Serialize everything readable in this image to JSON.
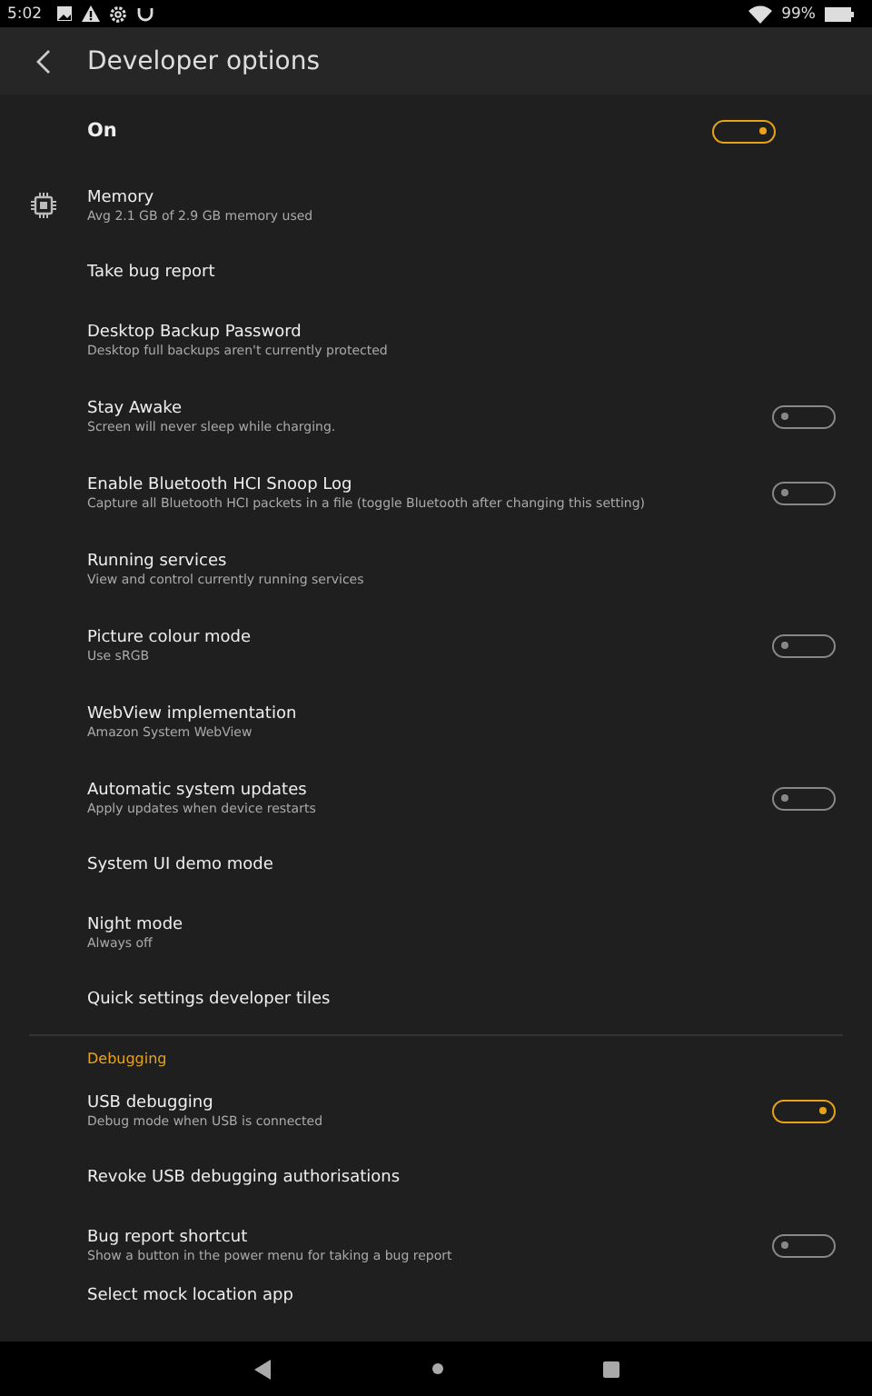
{
  "status_bar": {
    "time": "5:02",
    "battery": "99%"
  },
  "app_bar": {
    "title": "Developer options"
  },
  "master": {
    "label": "On",
    "on": true
  },
  "sections": [
    {
      "items": [
        {
          "kind": "icon",
          "title": "Memory",
          "summary": "Avg 2.1 GB of 2.9 GB memory used"
        },
        {
          "kind": "plain",
          "title": "Take bug report"
        },
        {
          "kind": "plain",
          "title": "Desktop Backup Password",
          "summary": "Desktop full backups aren't currently protected"
        },
        {
          "kind": "toggle",
          "title": "Stay Awake",
          "summary": "Screen will never sleep while charging.",
          "on": false
        },
        {
          "kind": "toggle",
          "title": "Enable Bluetooth HCI Snoop Log",
          "summary": "Capture all Bluetooth HCI packets in a file (toggle Bluetooth after changing this setting)",
          "on": false
        },
        {
          "kind": "plain",
          "title": "Running services",
          "summary": "View and control currently running services"
        },
        {
          "kind": "toggle",
          "title": "Picture colour mode",
          "summary": "Use sRGB",
          "on": false
        },
        {
          "kind": "plain",
          "title": "WebView implementation",
          "summary": "Amazon System WebView"
        },
        {
          "kind": "toggle",
          "title": "Automatic system updates",
          "summary": "Apply updates when device restarts",
          "on": false
        },
        {
          "kind": "plain",
          "title": "System UI demo mode"
        },
        {
          "kind": "plain",
          "title": "Night mode",
          "summary": "Always off"
        },
        {
          "kind": "plain",
          "title": "Quick settings developer tiles"
        }
      ]
    },
    {
      "header": "Debugging",
      "items": [
        {
          "kind": "toggle",
          "title": "USB debugging",
          "summary": "Debug mode when USB is connected",
          "on": true
        },
        {
          "kind": "plain",
          "title": "Revoke USB debugging authorisations"
        },
        {
          "kind": "toggle",
          "title": "Bug report shortcut",
          "summary": "Show a button in the power menu for taking a bug report",
          "on": false
        },
        {
          "kind": "plain",
          "title": "Select mock location app"
        }
      ]
    }
  ]
}
